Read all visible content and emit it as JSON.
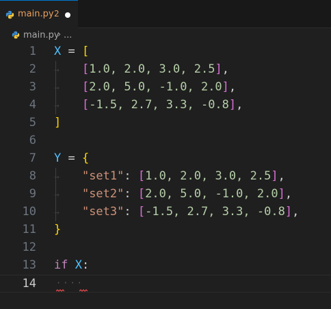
{
  "tab": {
    "filename": "main.py",
    "problems_count": "2",
    "icon": "python-icon",
    "unsaved": true
  },
  "breadcrumb": {
    "file": "main.py",
    "separator": "›",
    "more": "..."
  },
  "colors": {
    "variable": "#4fc1ff",
    "bracket_level1": "#ffd700",
    "bracket_level2": "#da70d6",
    "number": "#b5cea8",
    "string": "#ce9178",
    "keyword": "#c586c0",
    "tab_modified": "#e8a05e"
  },
  "editor": {
    "active_line": "14",
    "lines": [
      {
        "number": "1"
      },
      {
        "number": "2"
      },
      {
        "number": "3"
      },
      {
        "number": "4"
      },
      {
        "number": "5"
      },
      {
        "number": "6"
      },
      {
        "number": "7"
      },
      {
        "number": "8"
      },
      {
        "number": "9"
      },
      {
        "number": "10"
      },
      {
        "number": "11"
      },
      {
        "number": "12"
      },
      {
        "number": "13"
      },
      {
        "number": "14"
      }
    ],
    "code": {
      "l1_var": "X",
      "l1_op": " = ",
      "l1_open": "[",
      "l2_open": "[",
      "l2_vals": "1.0, 2.0, 3.0, 2.5",
      "l2_close": "]",
      "l2_comma": ",",
      "l3_open": "[",
      "l3_vals": "2.0, 5.0, -1.0, 2.0",
      "l3_close": "]",
      "l3_comma": ",",
      "l4_open": "[",
      "l4_vals": "-1.5, 2.7, 3.3, -0.8",
      "l4_close": "]",
      "l4_comma": ",",
      "l5_close": "]",
      "l7_var": "Y",
      "l7_op": " = ",
      "l7_open": "{",
      "l8_key": "\"set1\"",
      "l8_colon": ": ",
      "l8_open": "[",
      "l8_vals": "1.0, 2.0, 3.0, 2.5",
      "l8_close": "]",
      "l8_comma": ",",
      "l9_key": "\"set2\"",
      "l9_colon": ": ",
      "l9_open": "[",
      "l9_vals": "2.0, 5.0, -1.0, 2.0",
      "l9_close": "]",
      "l9_comma": ",",
      "l10_key": "\"set3\"",
      "l10_colon": ": ",
      "l10_open": "[",
      "l10_vals": "-1.5, 2.7, 3.3, -0.8",
      "l10_close": "]",
      "l10_comma": ",",
      "l11_close": "}",
      "l13_kw": "if",
      "l13_var": "X",
      "l13_colon": ":",
      "l14_ws": "····"
    },
    "indent_arrow": "→"
  }
}
